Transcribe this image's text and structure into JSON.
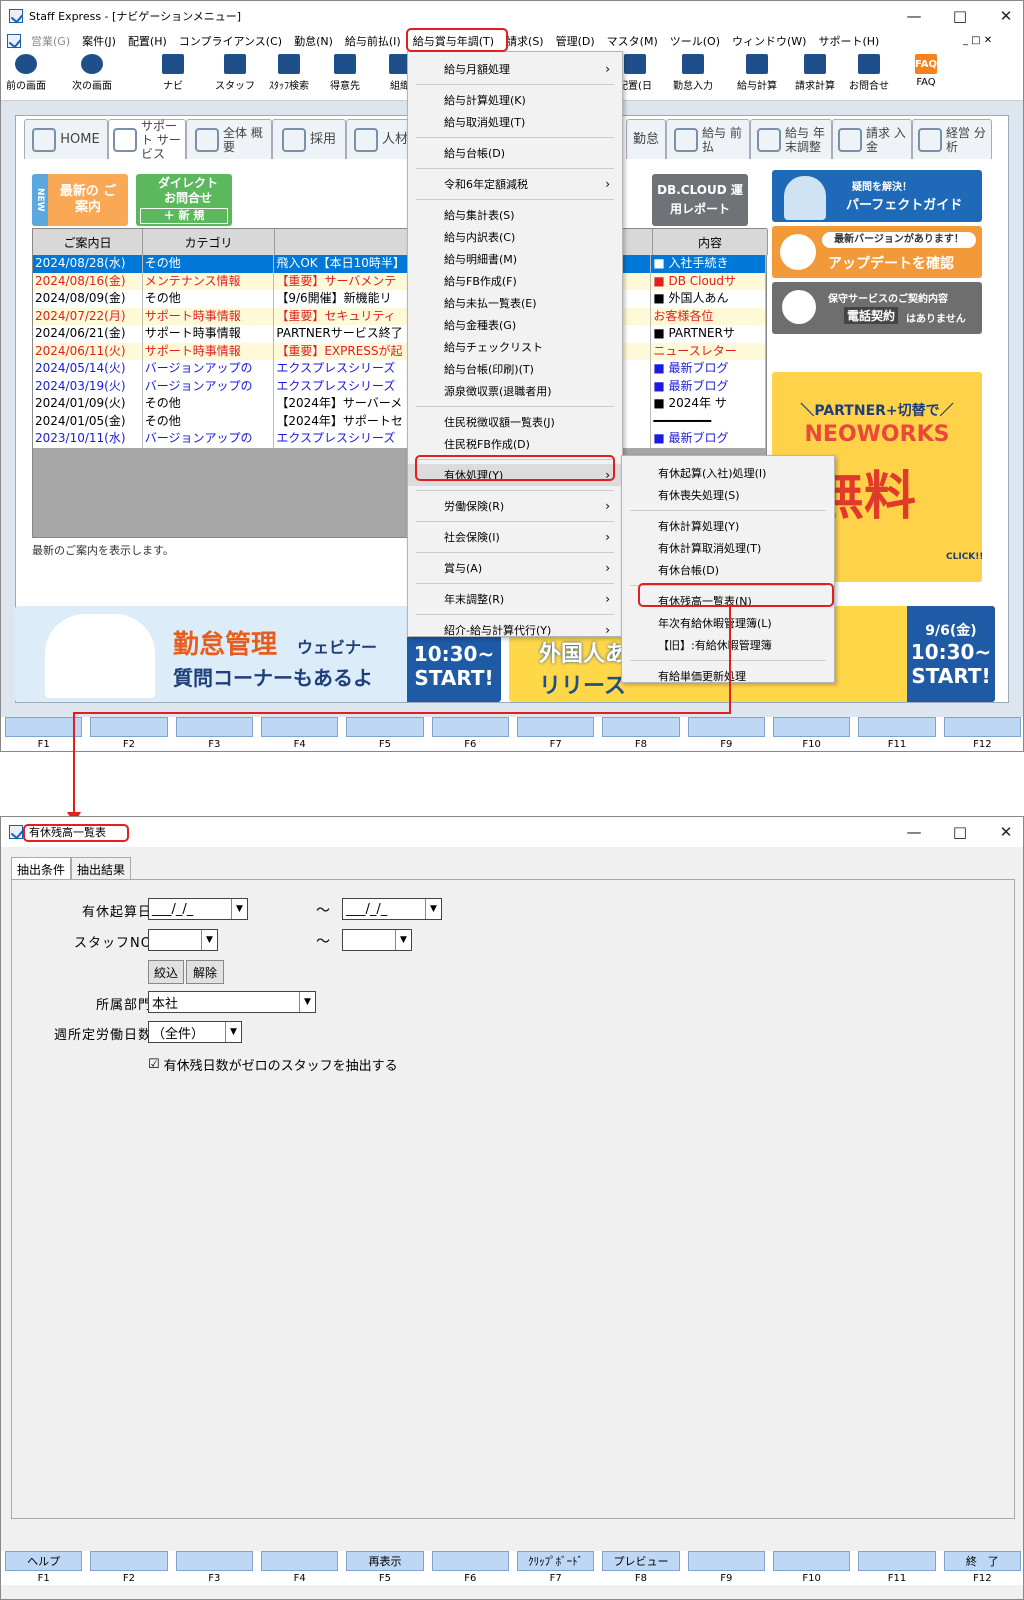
{
  "top_window": {
    "title": "Staff Express - [ナビゲーションメニュー]",
    "menubar": [
      "営業(G)",
      "案件(J)",
      "配置(H)",
      "コンプライアンス(C)",
      "勤怠(N)",
      "給与前払(I)",
      "給与賞与年調(T)",
      "請求(S)",
      "管理(D)",
      "マスタ(M)",
      "ツール(O)",
      "ウィンドウ(W)",
      "サポート(H)"
    ],
    "toolbar": [
      "前の画面",
      "次の画面",
      "ナビ",
      "スタッフ",
      "ｽﾀｯﾌ検索",
      "得意先",
      "組織",
      "配置(日",
      "勤怠入力",
      "給与計算",
      "請求計算",
      "お問合せ",
      "FAQ"
    ],
    "tabs": [
      "HOME",
      "サポート サービス",
      "全体 概要",
      "採用",
      "人材",
      "勤怠",
      "給与 前払",
      "給与 年末調整",
      "請求 入金",
      "経営 分析"
    ],
    "notice": {
      "new_label": "最新の ご案内",
      "new_tag": "NEW",
      "direct_label": "ダイレクト お問合せ",
      "direct_new": "＋ 新 規",
      "report_label": "DB.CLOUD 運用レポート",
      "headers": [
        "ご案内日",
        "カテゴリ",
        "",
        "内容"
      ],
      "rows": [
        {
          "date": "2024/08/28(水)",
          "cat": "その他",
          "title": "飛入OK【本日10時半】",
          "content": "■ 入社手続き",
          "style": "sel"
        },
        {
          "date": "2024/08/16(金)",
          "cat": "メンテナンス情報",
          "title": "【重要】サーバメンテ",
          "content": "■ DB Cloudサ",
          "style": "red"
        },
        {
          "date": "2024/08/09(金)",
          "cat": "その他",
          "title": "【9/6開催】新機能リ",
          "content": "■ 外国人あん",
          "style": "norm"
        },
        {
          "date": "2024/07/22(月)",
          "cat": "サポート時事情報",
          "title": "【重要】セキュリティ",
          "content": "お客様各位",
          "style": "red"
        },
        {
          "date": "2024/06/21(金)",
          "cat": "サポート時事情報",
          "title": "PARTNERサービス終了",
          "content": "■ PARTNERサ",
          "style": "norm"
        },
        {
          "date": "2024/06/11(火)",
          "cat": "サポート時事情報",
          "title": "【重要】EXPRESSが起",
          "content": "ニュースレター",
          "style": "red"
        },
        {
          "date": "2024/05/14(火)",
          "cat": "バージョンアップの",
          "title": "エクスプレスシリーズ",
          "content": "■ 最新ブログ",
          "style": "blue"
        },
        {
          "date": "2024/03/19(火)",
          "cat": "バージョンアップの",
          "title": "エクスプレスシリーズ",
          "content": "■ 最新ブログ",
          "style": "blue"
        },
        {
          "date": "2024/01/09(火)",
          "cat": "その他",
          "title": "【2024年】サーバーメ",
          "content": "■ 2024年 サ",
          "style": "norm"
        },
        {
          "date": "2024/01/05(金)",
          "cat": "その他",
          "title": "【2024年】サポートセ",
          "content": "━━━━━━━━",
          "style": "norm"
        },
        {
          "date": "2023/10/11(水)",
          "cat": "バージョンアップの",
          "title": "エクスプレスシリーズ",
          "content": "■ 最新ブログ",
          "style": "blue"
        }
      ],
      "status": "最新のご案内を表示します。"
    },
    "side_banners": {
      "guide_sub": "疑問を解決！",
      "guide": "パーフェクトガイド",
      "update_sub": "最新バージョンがあります！",
      "update": "アップデートを確認",
      "support_sub": "保守サービスのご契約内容",
      "support": "電話契約",
      "support_tail": "はありません",
      "neo_sub": "＼PARTNER+切替で／",
      "neo": "NEOWORKS",
      "neo_free": "無料",
      "neo_click": "CLICK!!"
    },
    "bottom_banners": {
      "left_main": "勤怠管理",
      "left_sub": "ウェビナー",
      "left_sub2": "質問コーナーもあるよ",
      "left_time": "10:30~",
      "left_start": "START!",
      "mid_main": "外国人あ",
      "mid_sub": "リリース",
      "right_date": "9/6(金)",
      "right_time": "10:30~",
      "right_start": "START!"
    },
    "main_menu": [
      {
        "label": "給与月額処理",
        "sub": true
      },
      {
        "sep": true
      },
      {
        "label": "給与計算処理(K)"
      },
      {
        "label": "給与取消処理(T)"
      },
      {
        "sep": true
      },
      {
        "label": "給与台帳(D)"
      },
      {
        "sep": true
      },
      {
        "label": "令和6年定額減税",
        "sub": true
      },
      {
        "sep": true
      },
      {
        "label": "給与集計表(S)"
      },
      {
        "label": "給与内訳表(C)"
      },
      {
        "label": "給与明細書(M)"
      },
      {
        "label": "給与FB作成(F)"
      },
      {
        "label": "給与未払一覧表(E)"
      },
      {
        "label": "給与金種表(G)"
      },
      {
        "label": "給与チェックリスト"
      },
      {
        "label": "給与台帳(印刷)(T)"
      },
      {
        "label": "源泉徴収票(退職者用)"
      },
      {
        "sep": true
      },
      {
        "label": "住民税徴収額一覧表(J)"
      },
      {
        "label": "住民税FB作成(D)"
      },
      {
        "sep": true
      },
      {
        "label": "有休処理(Y)",
        "sub": true,
        "active": true
      },
      {
        "sep": true
      },
      {
        "label": "労働保険(R)",
        "sub": true
      },
      {
        "sep": true
      },
      {
        "label": "社会保険(I)",
        "sub": true
      },
      {
        "sep": true
      },
      {
        "label": "賞与(A)",
        "sub": true
      },
      {
        "sep": true
      },
      {
        "label": "年末調整(R)",
        "sub": true
      },
      {
        "sep": true
      },
      {
        "label": "紹介-給与計算代行(Y)",
        "sub": true
      }
    ],
    "sub_menu": [
      {
        "label": "有休起算(入社)処理(I)"
      },
      {
        "label": "有休喪失処理(S)"
      },
      {
        "sep": true
      },
      {
        "label": "有休計算処理(Y)"
      },
      {
        "label": "有休計算取消処理(T)"
      },
      {
        "label": "有休台帳(D)"
      },
      {
        "sep": true
      },
      {
        "label": "有休残高一覧表(N)",
        "hl": true
      },
      {
        "label": "年次有給休暇管理簿(L)"
      },
      {
        "label": "【旧】:有給休暇管理簿"
      },
      {
        "sep": true
      },
      {
        "label": "有給単価更新処理"
      }
    ],
    "fkeys": [
      {
        "label": "",
        "key": "F1"
      },
      {
        "label": "",
        "key": "F2"
      },
      {
        "label": "",
        "key": "F3"
      },
      {
        "label": "",
        "key": "F4"
      },
      {
        "label": "",
        "key": "F5"
      },
      {
        "label": "",
        "key": "F6"
      },
      {
        "label": "",
        "key": "F7"
      },
      {
        "label": "",
        "key": "F8"
      },
      {
        "label": "",
        "key": "F9"
      },
      {
        "label": "",
        "key": "F10"
      },
      {
        "label": "",
        "key": "F11"
      },
      {
        "label": "",
        "key": "F12"
      }
    ]
  },
  "dialog": {
    "title": "有休残高一覧表",
    "tabs": [
      "抽出条件",
      "抽出結果"
    ],
    "fields": {
      "start_label": "有休起算日",
      "start_from": "___/_/_",
      "start_to": "___/_/_",
      "tilde": "～",
      "staff_label": "スタッフNO",
      "filter_btn": "絞込",
      "clear_btn": "解除",
      "dept_label": "所属部門",
      "dept_value": "本社",
      "days_label": "週所定労働日数",
      "days_value": "（全件）",
      "zero_check": "有休残日数がゼロのスタッフを抽出する",
      "zero_checked": "☑"
    },
    "fkeys": [
      {
        "label": "ヘルプ",
        "key": "F1"
      },
      {
        "label": "",
        "key": "F2"
      },
      {
        "label": "",
        "key": "F3"
      },
      {
        "label": "",
        "key": "F4"
      },
      {
        "label": "再表示",
        "key": "F5"
      },
      {
        "label": "",
        "key": "F6"
      },
      {
        "label": "ｸﾘｯﾌﾟﾎﾞｰﾄﾞ",
        "key": "F7"
      },
      {
        "label": "プレビュー",
        "key": "F8"
      },
      {
        "label": "",
        "key": "F9"
      },
      {
        "label": "",
        "key": "F10"
      },
      {
        "label": "",
        "key": "F11"
      },
      {
        "label": "終　了",
        "key": "F12"
      }
    ]
  },
  "colors": {
    "highlight": "#e02020",
    "selected": "#0078d7",
    "fkey": "#bdd7f5"
  }
}
